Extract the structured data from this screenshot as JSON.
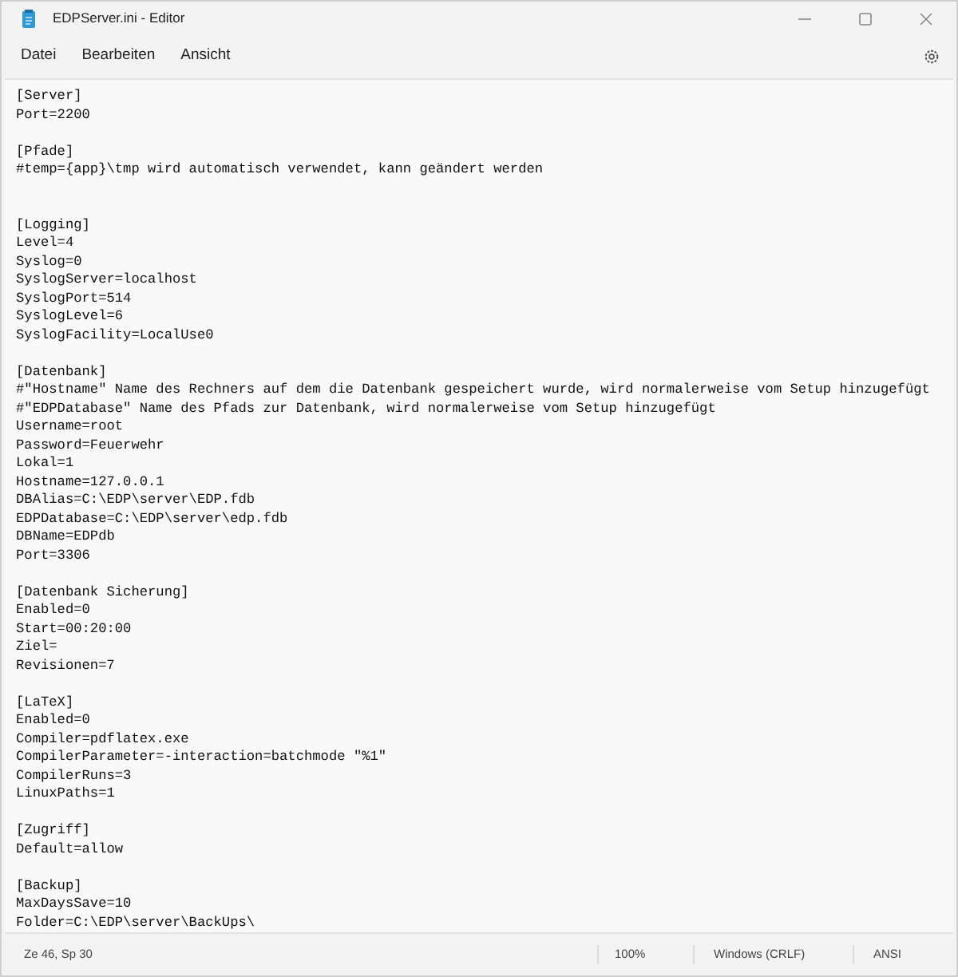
{
  "window": {
    "title": "EDPServer.ini - Editor"
  },
  "menu": [
    "Datei",
    "Bearbeiten",
    "Ansicht"
  ],
  "editor": {
    "content": "[Server]\nPort=2200\n\n[Pfade]\n#temp={app}\\tmp wird automatisch verwendet, kann geändert werden\n\n\n[Logging]\nLevel=4\nSyslog=0\nSyslogServer=localhost\nSyslogPort=514\nSyslogLevel=6\nSyslogFacility=LocalUse0\n\n[Datenbank]\n#\"Hostname\" Name des Rechners auf dem die Datenbank gespeichert wurde, wird normalerweise vom Setup hinzugefügt\n#\"EDPDatabase\" Name des Pfads zur Datenbank, wird normalerweise vom Setup hinzugefügt\nUsername=root\nPassword=Feuerwehr\nLokal=1\nHostname=127.0.0.1\nDBAlias=C:\\EDP\\server\\EDP.fdb\nEDPDatabase=C:\\EDP\\server\\edp.fdb\nDBName=EDPdb\nPort=3306\n\n[Datenbank Sicherung]\nEnabled=0\nStart=00:20:00\nZiel=\nRevisionen=7\n\n[LaTeX]\nEnabled=0\nCompiler=pdflatex.exe\nCompilerParameter=-interaction=batchmode \"%1\"\nCompilerRuns=3\nLinuxPaths=1\n\n[Zugriff]\nDefault=allow\n\n[Backup]\nMaxDaysSave=10\nFolder=C:\\EDP\\server\\BackUps\\"
  },
  "status_bar": {
    "position": "Ze 46, Sp 30",
    "zoom": "100%",
    "line_ending": "Windows (CRLF)",
    "encoding": "ANSI"
  }
}
